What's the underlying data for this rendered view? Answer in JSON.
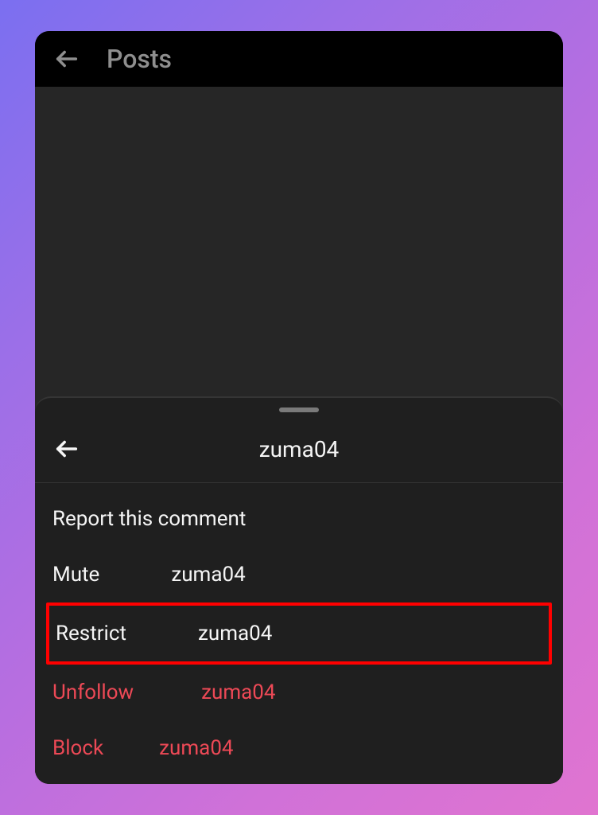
{
  "header": {
    "title": "Posts"
  },
  "sheet": {
    "username": "zuma04",
    "items": {
      "report": {
        "label": "Report this comment"
      },
      "mute": {
        "action": "Mute",
        "target": "zuma04"
      },
      "restrict": {
        "action": "Restrict",
        "target": "zuma04"
      },
      "unfollow": {
        "action": "Unfollow",
        "target": "zuma04"
      },
      "block": {
        "action": "Block",
        "target": "zuma04"
      }
    }
  }
}
